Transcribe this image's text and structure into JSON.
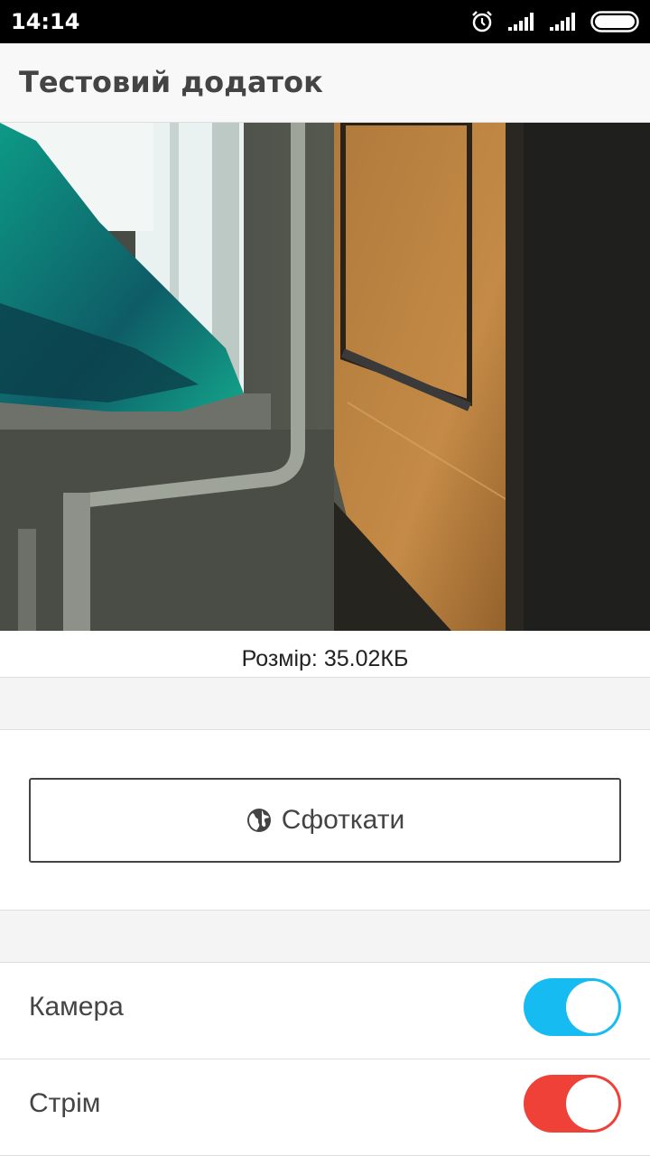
{
  "status_bar": {
    "time": "14:14",
    "icons": [
      "alarm-icon",
      "signal-icon",
      "signal-icon",
      "battery-icon"
    ]
  },
  "app_bar": {
    "title": "Тестовий додаток"
  },
  "photo": {
    "caption": "Розмір: 35.02КБ"
  },
  "actions": {
    "snap_label": "Сфоткати",
    "snap_icon": "globe-icon"
  },
  "settings": [
    {
      "label": "Камера",
      "on": true,
      "color": "#16bcf1"
    },
    {
      "label": "Стрім",
      "on": true,
      "color": "#ef4138"
    }
  ]
}
